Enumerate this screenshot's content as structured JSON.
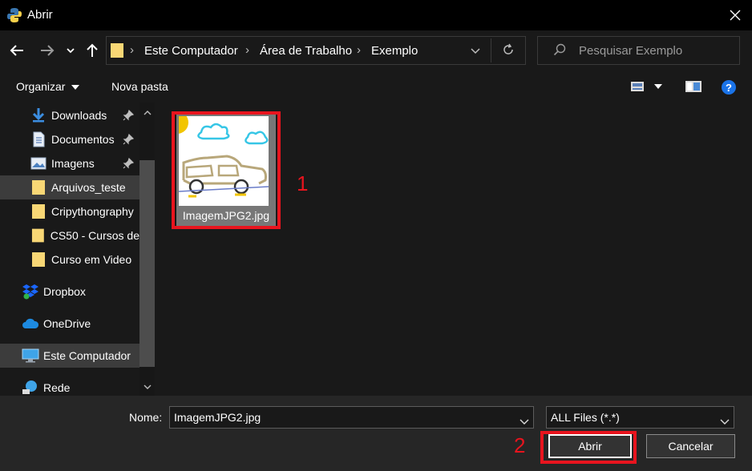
{
  "window": {
    "title": "Abrir"
  },
  "nav": {
    "breadcrumbs": [
      "Este Computador",
      "Área de Trabalho",
      "Exemplo"
    ],
    "search_placeholder": "Pesquisar Exemplo"
  },
  "toolbar": {
    "organize_label": "Organizar",
    "new_folder_label": "Nova pasta"
  },
  "sidebar": {
    "items": [
      {
        "label": "Downloads",
        "icon": "download-arrow-icon",
        "pinned": true
      },
      {
        "label": "Documentos",
        "icon": "document-icon",
        "pinned": true
      },
      {
        "label": "Imagens",
        "icon": "pictures-icon",
        "pinned": true
      },
      {
        "label": "Arquivos_teste",
        "icon": "folder-icon",
        "selected": true
      },
      {
        "label": "Cripythongraphy",
        "icon": "folder-icon"
      },
      {
        "label": "CS50 - Cursos de",
        "icon": "folder-icon"
      },
      {
        "label": "Curso em Video",
        "icon": "folder-icon"
      },
      {
        "label": "Dropbox",
        "icon": "dropbox-icon"
      },
      {
        "label": "OneDrive",
        "icon": "onedrive-cloud-icon"
      },
      {
        "label": "Este Computador",
        "icon": "computer-icon"
      },
      {
        "label": "Rede",
        "icon": "network-icon"
      }
    ]
  },
  "files": [
    {
      "name": "ImagemJPG2.jpg",
      "selected": true
    }
  ],
  "annotations": {
    "marker_1": "1",
    "marker_2": "2",
    "color": "#e8141e"
  },
  "bottom": {
    "name_label": "Nome:",
    "name_value": "ImagemJPG2.jpg",
    "filetype_value": "ALL Files (*.*)",
    "open_label": "Abrir",
    "cancel_label": "Cancelar"
  },
  "colors": {
    "background": "#191919",
    "titlebar": "#000000",
    "footer": "#262626",
    "folder": "#f8d775",
    "accent_blue": "#1a73e8"
  }
}
